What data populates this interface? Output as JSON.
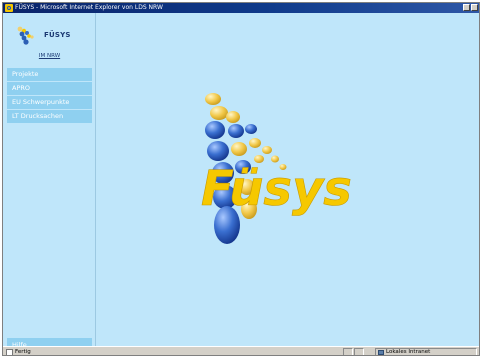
{
  "window": {
    "title": "FÜSYS - Microsoft Internet Explorer von LDS NRW"
  },
  "sidebar": {
    "logo_text": "FÜSYS",
    "im_nrw_link": "IM NRW",
    "items": [
      {
        "label": "Projekte"
      },
      {
        "label": "APRO"
      },
      {
        "label": "EU Schwerpunkte"
      },
      {
        "label": "LT Drucksachen"
      }
    ],
    "help_label": "Hilfe"
  },
  "main": {
    "logo_text": "Füsys"
  },
  "statusbar": {
    "status_text": "Fertig",
    "zone_text": "Lokales Intranet"
  },
  "colors": {
    "sidebar_bg": "#bfe6fa",
    "nav_item_bg": "#8fd0f0",
    "logo_yellow": "#f6c800",
    "logo_blue": "#2c5fb4"
  }
}
